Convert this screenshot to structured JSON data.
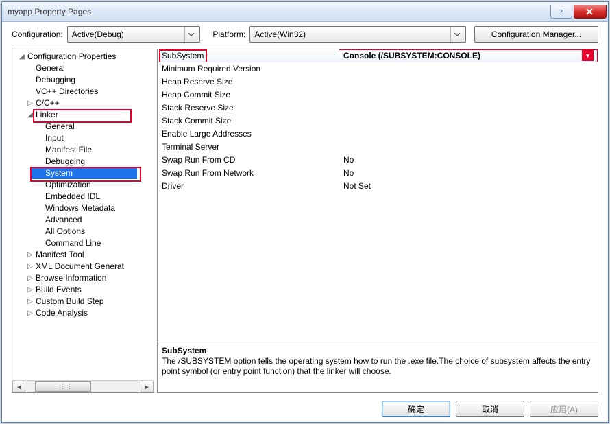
{
  "window": {
    "title": "myapp Property Pages"
  },
  "toolbar": {
    "config_label": "Configuration:",
    "config_value": "Active(Debug)",
    "platform_label": "Platform:",
    "platform_value": "Active(Win32)",
    "config_manager": "Configuration Manager..."
  },
  "tree": {
    "root": "Configuration Properties",
    "general": "General",
    "debugging": "Debugging",
    "vcpp_dirs": "VC++ Directories",
    "ccpp": "C/C++",
    "linker": "Linker",
    "linker_children": {
      "general": "General",
      "input": "Input",
      "manifest": "Manifest File",
      "debugging": "Debugging",
      "system": "System",
      "optimization": "Optimization",
      "embedded_idl": "Embedded IDL",
      "win_meta": "Windows Metadata",
      "advanced": "Advanced",
      "all_options": "All Options",
      "command_line": "Command Line"
    },
    "manifest_tool": "Manifest Tool",
    "xml_doc": "XML Document Generat",
    "browse_info": "Browse Information",
    "build_events": "Build Events",
    "custom_build": "Custom Build Step",
    "code_analysis": "Code Analysis"
  },
  "grid": {
    "rows": [
      {
        "name": "SubSystem",
        "value": "Console (/SUBSYSTEM:CONSOLE)"
      },
      {
        "name": "Minimum Required Version",
        "value": ""
      },
      {
        "name": "Heap Reserve Size",
        "value": ""
      },
      {
        "name": "Heap Commit Size",
        "value": ""
      },
      {
        "name": "Stack Reserve Size",
        "value": ""
      },
      {
        "name": "Stack Commit Size",
        "value": ""
      },
      {
        "name": "Enable Large Addresses",
        "value": ""
      },
      {
        "name": "Terminal Server",
        "value": ""
      },
      {
        "name": "Swap Run From CD",
        "value": "No"
      },
      {
        "name": "Swap Run From Network",
        "value": "No"
      },
      {
        "name": "Driver",
        "value": "Not Set"
      }
    ]
  },
  "desc": {
    "heading": "SubSystem",
    "body": "The /SUBSYSTEM option tells the operating system how to run the .exe file.The choice of subsystem affects the entry point symbol (or entry point function) that the linker will choose."
  },
  "buttons": {
    "ok": "确定",
    "cancel": "取消",
    "apply": "应用(A)"
  }
}
